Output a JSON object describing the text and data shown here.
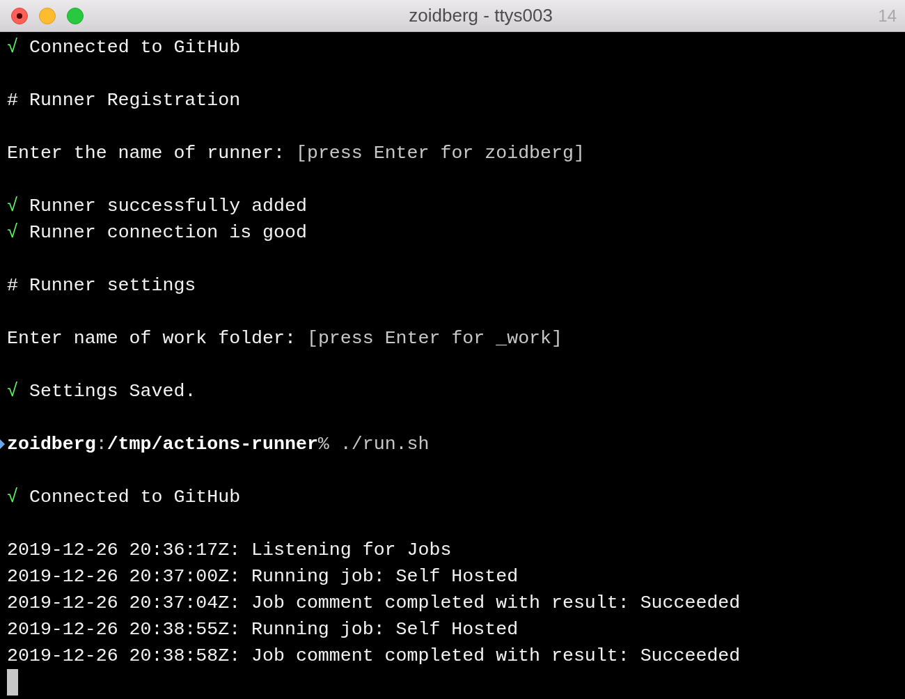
{
  "window": {
    "title": "zoidberg - ttys003",
    "tab_count": "14"
  },
  "lines": [
    {
      "kind": "output",
      "segments": [
        {
          "kind": "check",
          "text": "√"
        },
        {
          "kind": "text",
          "text": "Connected to GitHub"
        }
      ]
    },
    {
      "kind": "blank"
    },
    {
      "kind": "output",
      "segments": [
        {
          "kind": "text",
          "text": "# Runner Registration"
        }
      ]
    },
    {
      "kind": "blank"
    },
    {
      "kind": "output",
      "segments": [
        {
          "kind": "text",
          "text": "Enter the name of runner:"
        },
        {
          "kind": "hint",
          "text": "[press Enter for zoidberg]"
        }
      ]
    },
    {
      "kind": "blank"
    },
    {
      "kind": "output",
      "segments": [
        {
          "kind": "check",
          "text": "√"
        },
        {
          "kind": "text",
          "text": "Runner successfully added"
        }
      ]
    },
    {
      "kind": "output",
      "segments": [
        {
          "kind": "check",
          "text": "√"
        },
        {
          "kind": "text",
          "text": "Runner connection is good"
        }
      ]
    },
    {
      "kind": "blank"
    },
    {
      "kind": "output",
      "segments": [
        {
          "kind": "text",
          "text": "# Runner settings"
        }
      ]
    },
    {
      "kind": "blank"
    },
    {
      "kind": "output",
      "segments": [
        {
          "kind": "text",
          "text": "Enter name of work folder:"
        },
        {
          "kind": "hint",
          "text": "[press Enter for _work]"
        }
      ]
    },
    {
      "kind": "blank"
    },
    {
      "kind": "output",
      "segments": [
        {
          "kind": "check",
          "text": "√"
        },
        {
          "kind": "text",
          "text": "Settings Saved."
        }
      ]
    },
    {
      "kind": "blank"
    },
    {
      "kind": "prompt",
      "segments": [
        {
          "kind": "host",
          "text": "zoidberg"
        },
        {
          "kind": "sep",
          "text": ":"
        },
        {
          "kind": "path",
          "text": "/tmp/actions-runner"
        },
        {
          "kind": "sign",
          "text": "%"
        },
        {
          "kind": "command",
          "text": "./run.sh"
        }
      ]
    },
    {
      "kind": "blank"
    },
    {
      "kind": "output",
      "segments": [
        {
          "kind": "check",
          "text": "√"
        },
        {
          "kind": "text",
          "text": "Connected to GitHub"
        }
      ]
    },
    {
      "kind": "blank"
    },
    {
      "kind": "output",
      "segments": [
        {
          "kind": "text",
          "text": "2019-12-26 20:36:17Z: Listening for Jobs"
        }
      ]
    },
    {
      "kind": "output",
      "segments": [
        {
          "kind": "text",
          "text": "2019-12-26 20:37:00Z: Running job: Self Hosted"
        }
      ]
    },
    {
      "kind": "output",
      "segments": [
        {
          "kind": "text",
          "text": "2019-12-26 20:37:04Z: Job comment completed with result: Succeeded"
        }
      ]
    },
    {
      "kind": "output",
      "segments": [
        {
          "kind": "text",
          "text": "2019-12-26 20:38:55Z: Running job: Self Hosted"
        }
      ]
    },
    {
      "kind": "output",
      "segments": [
        {
          "kind": "text",
          "text": "2019-12-26 20:38:58Z: Job comment completed with result: Succeeded"
        }
      ]
    },
    {
      "kind": "cursor"
    }
  ]
}
